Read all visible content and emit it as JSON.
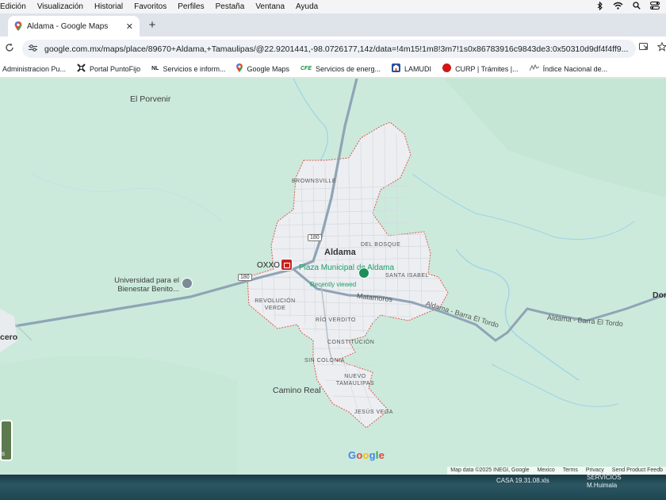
{
  "menubar": {
    "items": [
      "Edición",
      "Visualización",
      "Historial",
      "Favoritos",
      "Perfiles",
      "Pestaña",
      "Ventana",
      "Ayuda"
    ],
    "status_icons": [
      "bluetooth-icon",
      "wifi-icon",
      "search-icon",
      "control-center-icon"
    ]
  },
  "browser": {
    "tab_title": "Aldama - Google Maps",
    "tab_close": "✕",
    "new_tab": "+",
    "url": "google.com.mx/maps/place/89670+Aldama,+Tamaulipas/@22.9201441,-98.0726177,14z/data=!4m15!1m8!3m7!1s0x86783916c9843de3:0x50310d9df4f4ff9..."
  },
  "bookmarks": [
    {
      "label": "Administracion Pu...",
      "icon": ""
    },
    {
      "label": "Portal PuntoFijo",
      "icon": "puntofijo-icon"
    },
    {
      "label": "Servicios e inform...",
      "icon": "nl-icon",
      "glyph": "NL"
    },
    {
      "label": "Google Maps",
      "icon": "maps-pin-icon"
    },
    {
      "label": "Servicios de energ...",
      "icon": "cfe-icon",
      "glyph": "CFE"
    },
    {
      "label": "LAMUDI",
      "icon": "lamudi-icon"
    },
    {
      "label": "CURP | Trámites |...",
      "icon": "curp-icon"
    },
    {
      "label": "Índice Nacional de...",
      "icon": "inegi-icon"
    }
  ],
  "map": {
    "labels": {
      "el_porvenir": "El Porvenir",
      "brownsville": "BROWNSVILLE",
      "aldama": "Aldama",
      "del_bosque": "DEL BOSQUE",
      "oxxo": "OXXO",
      "plaza": "Plaza Municipal de Aldama",
      "recently_viewed": "Recently viewed",
      "santa_isabel": "SANTA ISABEL",
      "universidad": "Universidad para el Bienestar Benito...",
      "revolucion_verde": "REVOLUCIÓN VERDE",
      "matamoros": "Matamoros",
      "aldama_barra": "Aldama - Barra El Tordo",
      "aldama_barra2": "Aldama - Barra El Tordo",
      "rio_verdito": "RÍO VERDITO",
      "constitucion": "CONSTITUCIÓN",
      "sin_colonia": "SIN COLONIA",
      "nuevo_tamaulipas": "NUEVO TAMAULIPAS",
      "camino_real": "Camino Real",
      "jesus_vega": "JESÚS VEGA",
      "cero": "cero",
      "dor": "Dor",
      "shield_180a": "180",
      "shield_180b": "180"
    },
    "google_logo": [
      "G",
      "o",
      "o",
      "g",
      "l",
      "e"
    ],
    "attribution": [
      "Map data ©2025 INEGI, Google",
      "Mexico",
      "Terms",
      "Privacy",
      "Send Product Feedb"
    ],
    "layer_label": "s"
  },
  "desktop": {
    "file1": "CASA 19.31.08.xls",
    "file2_line1": "SERVICIOS",
    "file2_line2": "M.Huimala"
  }
}
